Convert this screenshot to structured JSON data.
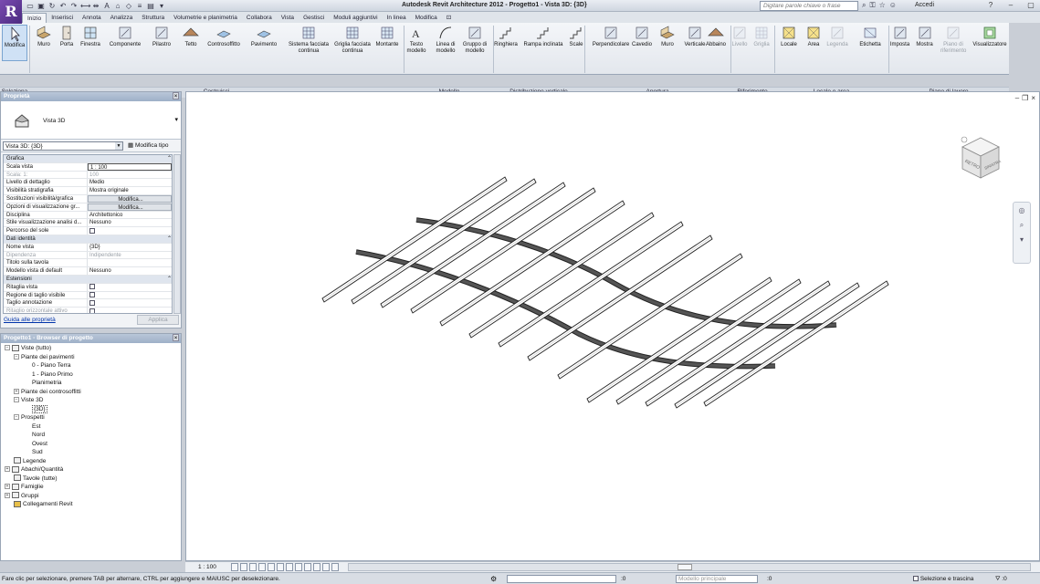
{
  "app": {
    "logo_letter": "R",
    "title": "Autodesk Revit Architecture 2012 -    Progetto1 - Vista 3D: {3D}",
    "search_placeholder": "Digitare parole chiave o frase",
    "login_label": "Accedi"
  },
  "ribbon": {
    "tabs": [
      {
        "label": "Inizio",
        "active": true
      },
      {
        "label": "Inserisci"
      },
      {
        "label": "Annota"
      },
      {
        "label": "Analizza"
      },
      {
        "label": "Struttura"
      },
      {
        "label": "Volumetrie e planimetria"
      },
      {
        "label": "Collabora"
      },
      {
        "label": "Vista"
      },
      {
        "label": "Gestisci"
      },
      {
        "label": "Moduli aggiuntivi"
      },
      {
        "label": "In linea"
      },
      {
        "label": "Modifica"
      }
    ],
    "buttons": [
      {
        "label": "Modifica",
        "icon": "cursor-icon",
        "selected": true
      },
      {
        "label": "Muro",
        "icon": "wall-icon"
      },
      {
        "label": "Porta",
        "icon": "door-icon"
      },
      {
        "label": "Finestra",
        "icon": "window-icon"
      },
      {
        "label": "Componente",
        "icon": "component-icon"
      },
      {
        "label": "Pilastro",
        "icon": "column-icon"
      },
      {
        "label": "Tetto",
        "icon": "roof-icon"
      },
      {
        "label": "Controsoffitto",
        "icon": "ceiling-icon"
      },
      {
        "label": "Pavimento",
        "icon": "floor-icon"
      },
      {
        "label": "Sistema facciata continua",
        "icon": "curtain-system-icon"
      },
      {
        "label": "Griglia facciata continua",
        "icon": "curtain-grid-icon"
      },
      {
        "label": "Montante",
        "icon": "mullion-icon"
      },
      {
        "label": "Testo modello",
        "icon": "model-text-icon"
      },
      {
        "label": "Linea di modello",
        "icon": "model-line-icon"
      },
      {
        "label": "Gruppo di modello",
        "icon": "model-group-icon"
      },
      {
        "label": "Ringhiera",
        "icon": "railing-icon"
      },
      {
        "label": "Rampa inclinata",
        "icon": "ramp-icon"
      },
      {
        "label": "Scale",
        "icon": "stair-icon"
      },
      {
        "label": "Perpendicolare",
        "icon": "perpendicular-icon"
      },
      {
        "label": "Cavedio",
        "icon": "shaft-icon"
      },
      {
        "label": "Muro",
        "icon": "wall-opening-icon"
      },
      {
        "label": "Verticale",
        "icon": "vertical-icon"
      },
      {
        "label": "Abbaino",
        "icon": "dormer-icon"
      },
      {
        "label": "Livello",
        "icon": "level-icon",
        "disabled": true
      },
      {
        "label": "Griglia",
        "icon": "grid-icon",
        "disabled": true
      },
      {
        "label": "Locale",
        "icon": "room-icon"
      },
      {
        "label": "Area",
        "icon": "area-icon"
      },
      {
        "label": "Legenda",
        "icon": "legend-icon",
        "disabled": true
      },
      {
        "label": "Etichetta",
        "icon": "tag-icon"
      },
      {
        "label": "Imposta",
        "icon": "set-icon"
      },
      {
        "label": "Mostra",
        "icon": "show-icon"
      },
      {
        "label": "Piano di riferimento",
        "icon": "ref-plane-icon",
        "disabled": true
      },
      {
        "label": "Visualizzatore",
        "icon": "viewer-icon"
      }
    ],
    "panels": [
      "Seleziona",
      "Costruisci",
      "Modello",
      "Distribuzione verticale",
      "Apertura",
      "Riferimento",
      "Locale e area",
      "Piano di lavoro"
    ]
  },
  "properties": {
    "title": "Proprietà",
    "type_name": "Vista 3D",
    "instance_select": "Vista 3D: {3D}",
    "edit_type_label": "Modifica tipo",
    "rows": [
      {
        "k": "Grafica",
        "section": true
      },
      {
        "k": "Scala vista",
        "v": "1 : 100",
        "input": true
      },
      {
        "k": "Scala: 1:",
        "v": "100",
        "dim": true
      },
      {
        "k": "Livello di dettaglio",
        "v": "Medio"
      },
      {
        "k": "Visibilità stratigrafia",
        "v": "Mostra originale"
      },
      {
        "k": "Sostituzioni visibilità/grafica",
        "v": "Modifica...",
        "btn": true
      },
      {
        "k": "Opzioni di visualizzazione gr...",
        "v": "Modifica...",
        "btn": true
      },
      {
        "k": "Disciplina",
        "v": "Architettonico"
      },
      {
        "k": "Stile visualizzazione analisi d...",
        "v": "Nessuno"
      },
      {
        "k": "Percorso del sole",
        "v": "",
        "check": true
      },
      {
        "k": "Dati identità",
        "section": true
      },
      {
        "k": "Nome vista",
        "v": "{3D}"
      },
      {
        "k": "Dipendenza",
        "v": "Indipendente",
        "dim": true
      },
      {
        "k": "Titolo sulla tavola",
        "v": ""
      },
      {
        "k": "Modello vista di default",
        "v": "Nessuno"
      },
      {
        "k": "Estensioni",
        "section": true
      },
      {
        "k": "Ritaglia vista",
        "v": "",
        "check": true
      },
      {
        "k": "Regione di taglio visibile",
        "v": "",
        "check": true
      },
      {
        "k": "Taglio annotazione",
        "v": "",
        "check": true
      },
      {
        "k": "Ritaglio orizzontale attivo",
        "v": "",
        "check": true,
        "dim": true
      }
    ],
    "help_link": "Guida alle proprietà",
    "apply_label": "Applica"
  },
  "browser": {
    "title": "Progetto1 - Browser di progetto",
    "nodes": [
      {
        "label": "Viste (tutto)",
        "level": 0,
        "toggle": "−",
        "icon": "views-icon"
      },
      {
        "label": "Piante dei pavimenti",
        "level": 1,
        "toggle": "−"
      },
      {
        "label": "0 - Piano Terra",
        "level": 2
      },
      {
        "label": "1 - Piano Primo",
        "level": 2
      },
      {
        "label": "Planimetria",
        "level": 2
      },
      {
        "label": "Piante dei controsoffitti",
        "level": 1,
        "toggle": "+"
      },
      {
        "label": "Viste 3D",
        "level": 1,
        "toggle": "−"
      },
      {
        "label": "{3D}",
        "level": 2,
        "selected": true
      },
      {
        "label": "Prospetti",
        "level": 1,
        "toggle": "−"
      },
      {
        "label": "Est",
        "level": 2
      },
      {
        "label": "Nord",
        "level": 2
      },
      {
        "label": "Ovest",
        "level": 2
      },
      {
        "label": "Sud",
        "level": 2
      },
      {
        "label": "Legende",
        "level": 0,
        "icon": "legend-icon"
      },
      {
        "label": "Abachi/Quantità",
        "level": 0,
        "toggle": "+",
        "icon": "schedule-icon"
      },
      {
        "label": "Tavole (tutte)",
        "level": 0,
        "icon": "sheet-icon"
      },
      {
        "label": "Famiglie",
        "level": 0,
        "toggle": "+",
        "icon": "family-icon"
      },
      {
        "label": "Gruppi",
        "level": 0,
        "toggle": "+",
        "icon": "group-icon"
      },
      {
        "label": "Collegamenti Revit",
        "level": 0,
        "icon": "link-icon"
      }
    ]
  },
  "viewcube": {
    "face_left": "RETRO",
    "face_right": "SINISTRA"
  },
  "viewbar": {
    "scale": "1 : 100"
  },
  "status": {
    "message": "Fare clic per selezionare, premere TAB per alternare, CTRL per aggiungere e MAIUSC per deselezionare.",
    "count1": ":0",
    "model_placeholder": "Modello principale",
    "count2": ":0",
    "drag_label": "Selezione e trascina",
    "filter_count": ":0"
  },
  "colors": {
    "beam_fill": "#ffffff",
    "beam_stroke": "#222222",
    "curve_fill": "#555555",
    "selection_blue": "#cfe1f5"
  }
}
